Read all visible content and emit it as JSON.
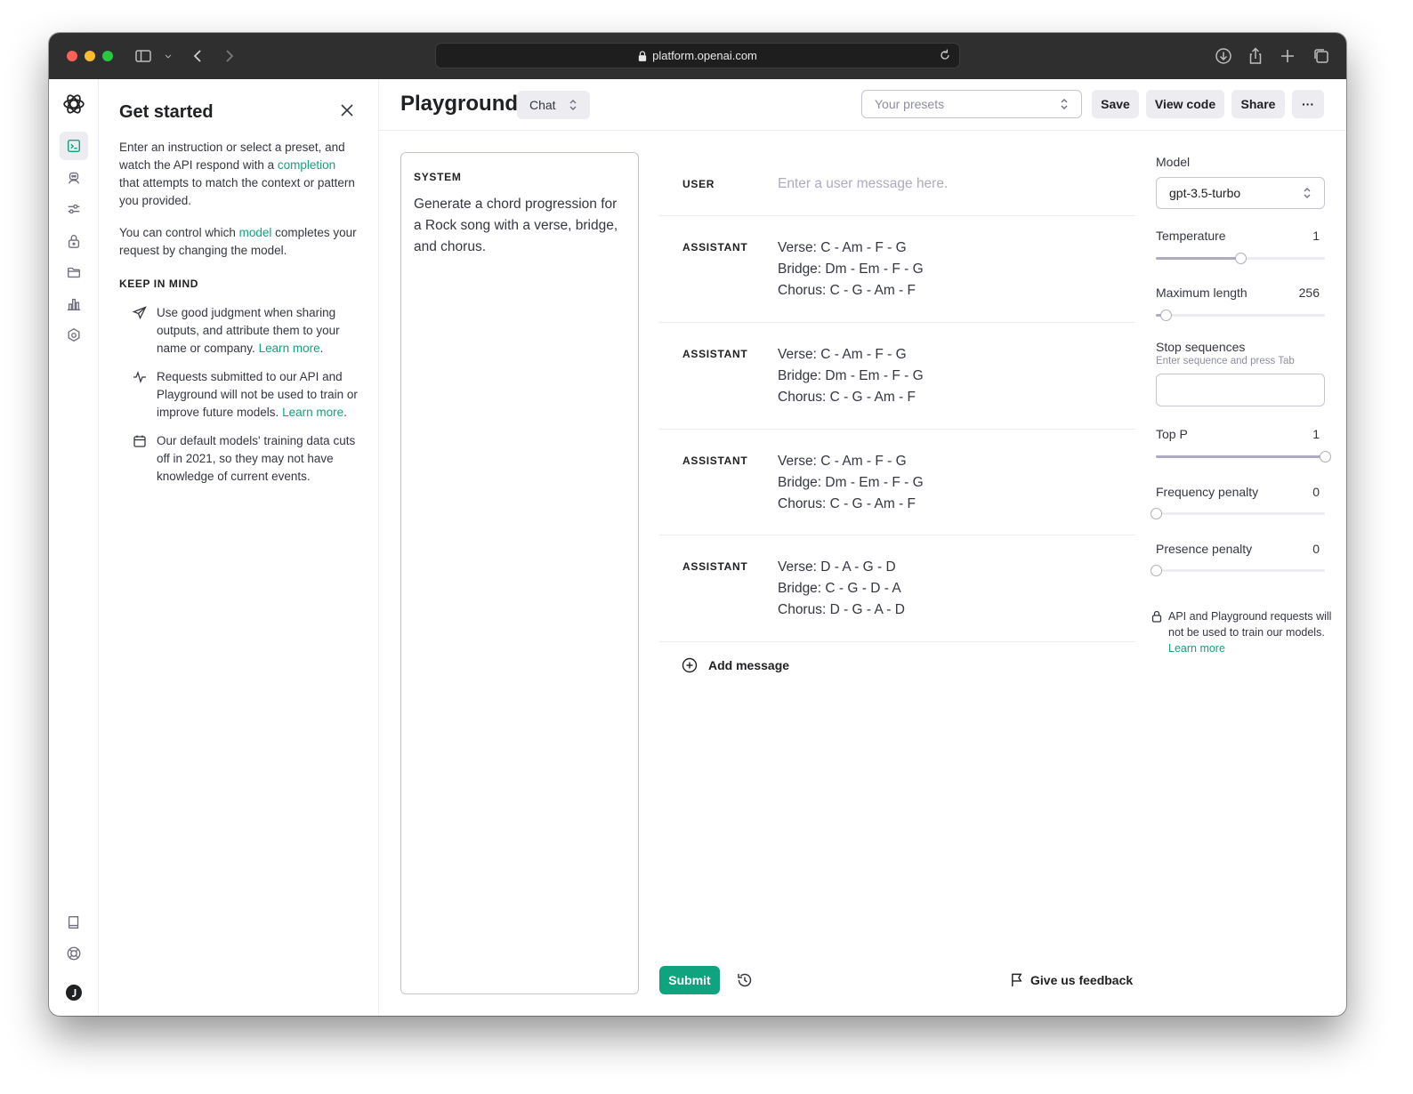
{
  "browser": {
    "url": "platform.openai.com"
  },
  "get_started": {
    "title": "Get started",
    "intro_part1": "Enter an instruction or select a preset, and watch the API respond with a ",
    "intro_link": "completion",
    "intro_part2": " that attempts to match the context or pattern you provided.",
    "model_part1": "You can control which ",
    "model_link": "model",
    "model_part2": " completes your request by changing the model.",
    "keep_in_mind_title": "KEEP IN MIND",
    "items": [
      {
        "icon": "send-icon",
        "text": "Use good judgment when sharing outputs, and attribute them to your name or company. ",
        "link": "Learn more",
        "after": "."
      },
      {
        "icon": "activity-icon",
        "text": "Requests submitted to our API and Playground will not be used to train or improve future models. ",
        "link": "Learn more",
        "after": "."
      },
      {
        "icon": "calendar-icon",
        "text": "Our default models' training data cuts off in 2021, so they may not have knowledge of current events.",
        "link": "",
        "after": ""
      }
    ]
  },
  "header": {
    "title": "Playground",
    "mode": "Chat",
    "presets_placeholder": "Your presets",
    "save_label": "Save",
    "view_code_label": "View code",
    "share_label": "Share",
    "more_label": "···"
  },
  "system": {
    "label": "SYSTEM",
    "text": "Generate a chord progression for a Rock song with a verse, bridge, and chorus."
  },
  "messages": {
    "user_label": "USER",
    "user_placeholder": "Enter a user message here.",
    "list": [
      {
        "role": "ASSISTANT",
        "text": "Verse: C - Am - F - G\nBridge: Dm - Em - F - G\nChorus: C - G - Am - F"
      },
      {
        "role": "ASSISTANT",
        "text": "Verse: C - Am - F - G\nBridge: Dm - Em - F - G\nChorus: C - G - Am - F"
      },
      {
        "role": "ASSISTANT",
        "text": "Verse: C - Am - F - G\nBridge: Dm - Em - F - G\nChorus: C - G - Am - F"
      },
      {
        "role": "ASSISTANT",
        "text": "Verse: D - A - G - D\nBridge: C - G - D - A\nChorus: D - G - A - D"
      }
    ],
    "add_message_label": "Add message"
  },
  "footer": {
    "submit_label": "Submit",
    "feedback_label": "Give us feedback"
  },
  "settings": {
    "model_label": "Model",
    "model_value": "gpt-3.5-turbo",
    "temperature_label": "Temperature",
    "temperature_value": "1",
    "temperature_fraction": 0.5,
    "max_length_label": "Maximum length",
    "max_length_value": "256",
    "max_length_fraction": 0.06,
    "stop_label": "Stop sequences",
    "stop_hint": "Enter sequence and press Tab",
    "top_p_label": "Top P",
    "top_p_value": "1",
    "top_p_fraction": 1.0,
    "freq_label": "Frequency penalty",
    "freq_value": "0",
    "freq_fraction": 0.0,
    "presence_label": "Presence penalty",
    "presence_value": "0",
    "presence_fraction": 0.0
  },
  "privacy": {
    "text": "API and Playground requests will not be used to train our models. ",
    "link": "Learn more"
  },
  "colors": {
    "accent": "#10a37f"
  }
}
